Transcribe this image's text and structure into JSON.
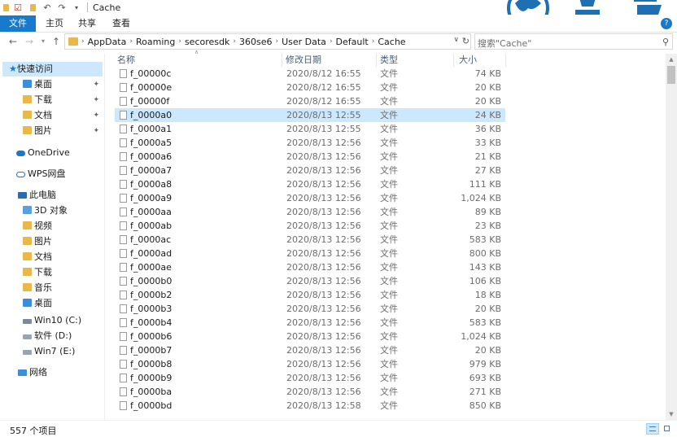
{
  "window": {
    "title": "Cache"
  },
  "ribbon": {
    "tabs": [
      "文件",
      "主页",
      "共享",
      "查看"
    ],
    "help": "?"
  },
  "address": {
    "crumbs": [
      "AppData",
      "Roaming",
      "secoresdk",
      "360se6",
      "User Data",
      "Default",
      "Cache"
    ],
    "search_placeholder": "搜索\"Cache\""
  },
  "sidebar": {
    "items": [
      {
        "label": "快速访问",
        "icon": "star-icon",
        "selected": true
      },
      {
        "label": "桌面",
        "icon": "desktop-folder-icon",
        "pinned": true
      },
      {
        "label": "下载",
        "icon": "download-folder-icon",
        "pinned": true
      },
      {
        "label": "文档",
        "icon": "documents-folder-icon",
        "pinned": true
      },
      {
        "label": "图片",
        "icon": "pictures-folder-icon",
        "pinned": true
      },
      {
        "label": "OneDrive",
        "icon": "cloud-icon"
      },
      {
        "label": "WPS网盘",
        "icon": "cloud-outline-icon"
      },
      {
        "label": "此电脑",
        "icon": "computer-icon"
      },
      {
        "label": "3D 对象",
        "icon": "3d-objects-icon"
      },
      {
        "label": "视频",
        "icon": "videos-folder-icon"
      },
      {
        "label": "图片",
        "icon": "pictures-folder-icon"
      },
      {
        "label": "文档",
        "icon": "documents-folder-icon"
      },
      {
        "label": "下载",
        "icon": "download-folder-icon"
      },
      {
        "label": "音乐",
        "icon": "music-folder-icon"
      },
      {
        "label": "桌面",
        "icon": "desktop-folder-icon"
      },
      {
        "label": "Win10 (C:)",
        "icon": "system-drive-icon"
      },
      {
        "label": "软件 (D:)",
        "icon": "drive-icon"
      },
      {
        "label": "Win7 (E:)",
        "icon": "drive-icon"
      },
      {
        "label": "网络",
        "icon": "network-icon"
      }
    ]
  },
  "columns": {
    "name": "名称",
    "date": "修改日期",
    "type": "类型",
    "size": "大小"
  },
  "files": [
    {
      "name": "f_00000c",
      "date": "2020/8/12 16:55",
      "type": "文件",
      "size": "74 KB"
    },
    {
      "name": "f_00000e",
      "date": "2020/8/12 16:55",
      "type": "文件",
      "size": "20 KB"
    },
    {
      "name": "f_00000f",
      "date": "2020/8/12 16:55",
      "type": "文件",
      "size": "20 KB"
    },
    {
      "name": "f_0000a0",
      "date": "2020/8/13 12:55",
      "type": "文件",
      "size": "24 KB",
      "selected": true
    },
    {
      "name": "f_0000a1",
      "date": "2020/8/13 12:55",
      "type": "文件",
      "size": "36 KB"
    },
    {
      "name": "f_0000a5",
      "date": "2020/8/13 12:56",
      "type": "文件",
      "size": "33 KB"
    },
    {
      "name": "f_0000a6",
      "date": "2020/8/13 12:56",
      "type": "文件",
      "size": "21 KB"
    },
    {
      "name": "f_0000a7",
      "date": "2020/8/13 12:56",
      "type": "文件",
      "size": "27 KB"
    },
    {
      "name": "f_0000a8",
      "date": "2020/8/13 12:56",
      "type": "文件",
      "size": "111 KB"
    },
    {
      "name": "f_0000a9",
      "date": "2020/8/13 12:56",
      "type": "文件",
      "size": "1,024 KB"
    },
    {
      "name": "f_0000aa",
      "date": "2020/8/13 12:56",
      "type": "文件",
      "size": "89 KB"
    },
    {
      "name": "f_0000ab",
      "date": "2020/8/13 12:56",
      "type": "文件",
      "size": "23 KB"
    },
    {
      "name": "f_0000ac",
      "date": "2020/8/13 12:56",
      "type": "文件",
      "size": "583 KB"
    },
    {
      "name": "f_0000ad",
      "date": "2020/8/13 12:56",
      "type": "文件",
      "size": "800 KB"
    },
    {
      "name": "f_0000ae",
      "date": "2020/8/13 12:56",
      "type": "文件",
      "size": "143 KB"
    },
    {
      "name": "f_0000b0",
      "date": "2020/8/13 12:56",
      "type": "文件",
      "size": "106 KB"
    },
    {
      "name": "f_0000b2",
      "date": "2020/8/13 12:56",
      "type": "文件",
      "size": "18 KB"
    },
    {
      "name": "f_0000b3",
      "date": "2020/8/13 12:56",
      "type": "文件",
      "size": "20 KB"
    },
    {
      "name": "f_0000b4",
      "date": "2020/8/13 12:56",
      "type": "文件",
      "size": "583 KB"
    },
    {
      "name": "f_0000b6",
      "date": "2020/8/13 12:56",
      "type": "文件",
      "size": "1,024 KB"
    },
    {
      "name": "f_0000b7",
      "date": "2020/8/13 12:56",
      "type": "文件",
      "size": "20 KB"
    },
    {
      "name": "f_0000b8",
      "date": "2020/8/13 12:56",
      "type": "文件",
      "size": "979 KB"
    },
    {
      "name": "f_0000b9",
      "date": "2020/8/13 12:56",
      "type": "文件",
      "size": "693 KB"
    },
    {
      "name": "f_0000ba",
      "date": "2020/8/13 12:56",
      "type": "文件",
      "size": "271 KB"
    },
    {
      "name": "f_0000bd",
      "date": "2020/8/13 12:58",
      "type": "文件",
      "size": "850 KB"
    }
  ],
  "status": {
    "item_count": "557 个项目"
  },
  "colors": {
    "accent": "#1979ca",
    "selection": "#cce8ff",
    "header_text": "#4c607a",
    "folder": "#e8b84a"
  }
}
